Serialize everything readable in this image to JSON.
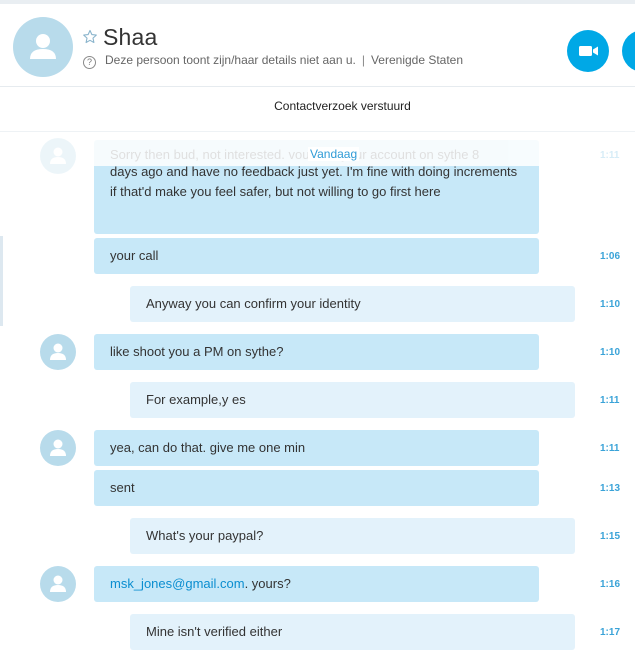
{
  "header": {
    "name": "Shaa",
    "status_text": "Deze persoon toont zijn/haar details niet aan u.",
    "separator": "|",
    "location": "Verenigde Staten",
    "info_glyph": "?"
  },
  "request_banner": "Contactverzoek verstuurd",
  "day_divider": "Vandaag",
  "messages": [
    {
      "dir": "in",
      "text": "Sorry then bud, not interested. vouched your account on sythe 8",
      "time": "1:11",
      "faded": true
    },
    {
      "dir": "in",
      "text": "days ago and have no feedback just yet. I'm fine with doing increments if that'd make you feel safer, but not willing to go first here",
      "time": ""
    },
    {
      "dir": "in",
      "text": "your call",
      "time": "1:06"
    },
    {
      "dir": "out",
      "text": "Anyway you can confirm your identity",
      "time": "1:10"
    },
    {
      "dir": "in",
      "text": "like shoot you a PM on sythe?",
      "time": "1:10"
    },
    {
      "dir": "out",
      "text": "For example,y es",
      "time": "1:11"
    },
    {
      "dir": "in",
      "text": "yea, can do that. give me one min",
      "time": "1:11"
    },
    {
      "dir": "in",
      "text": "sent",
      "time": "1:13"
    },
    {
      "dir": "out",
      "text": "What's your paypal?",
      "time": "1:15"
    },
    {
      "dir": "in",
      "link": "msk_jones@gmail.com",
      "text": ". yours?",
      "time": "1:16"
    },
    {
      "dir": "out",
      "text": "Mine isn't verified either",
      "time": "1:17"
    }
  ],
  "icons": {
    "avatar": "person-icon",
    "favorite": "star-outline-icon",
    "video": "video-camera-icon",
    "call": "phone-icon",
    "info": "info-circle-icon"
  },
  "colors": {
    "accent": "#00a8e6",
    "incoming_bubble": "#c7e8f8",
    "outgoing_bubble": "#e3f2fb",
    "timestamp": "#3aa3d8",
    "link": "#0b8ed0"
  }
}
